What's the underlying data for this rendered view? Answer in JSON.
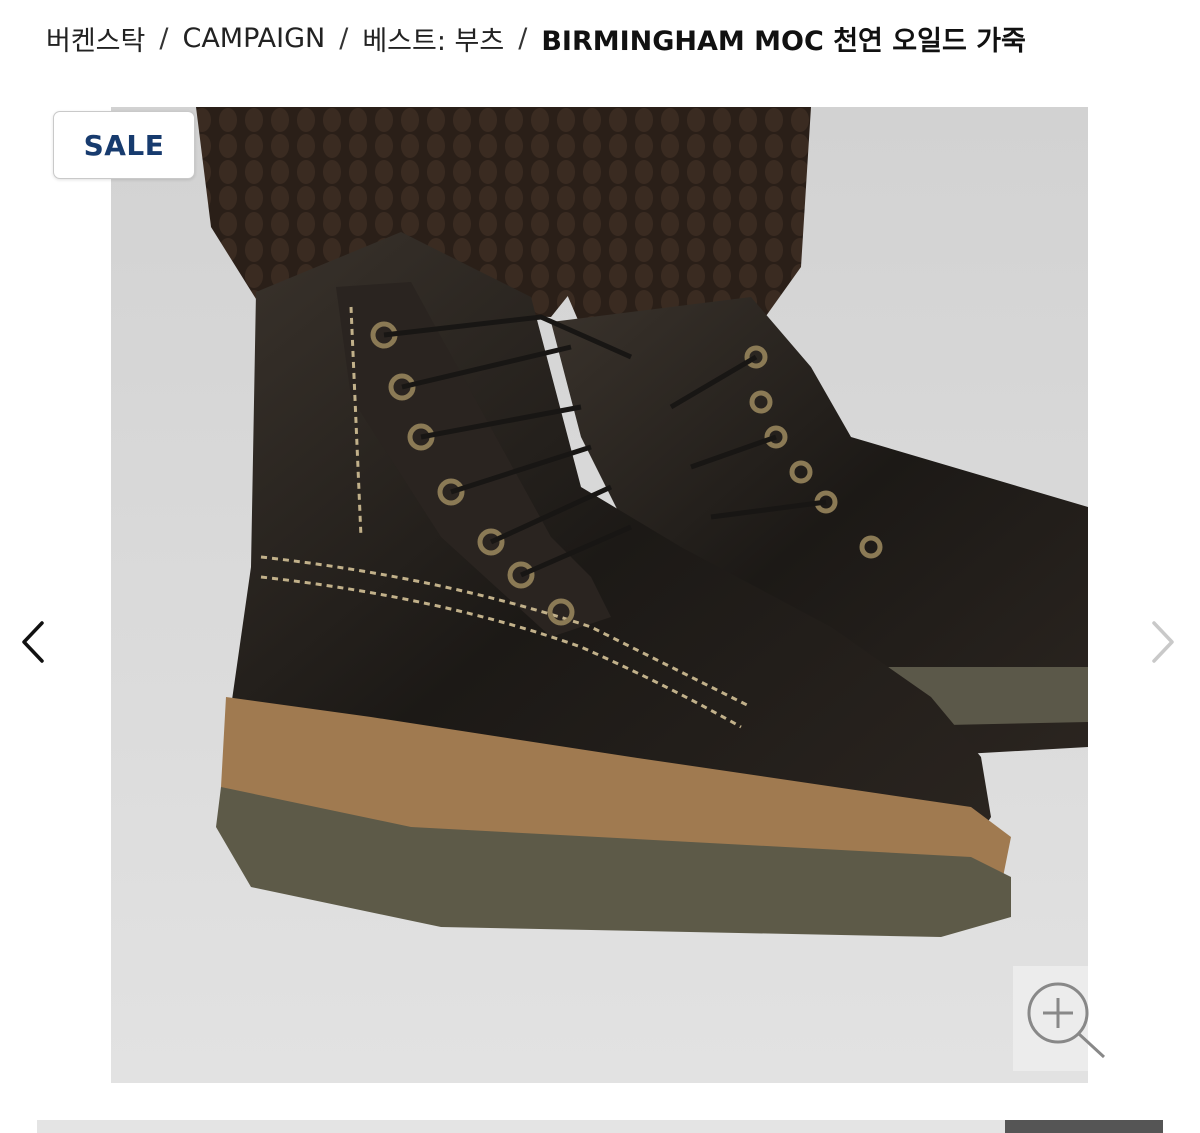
{
  "breadcrumb": {
    "items": [
      "버켄스탁",
      "CAMPAIGN",
      "베스트: 부츠"
    ],
    "current": "BIRMINGHAM MOC 천연 오일드 가죽",
    "separator": "/"
  },
  "product": {
    "badge": "SALE",
    "badge_color": "#173b6e",
    "image_alt": "Birmingham Moc boots"
  },
  "gallery": {
    "prev_icon": "chevron-left-icon",
    "next_icon": "chevron-right-icon",
    "zoom_icon": "magnifier-plus-icon",
    "slide_position_fraction": 0.86,
    "slide_indicator_width_fraction": 0.14
  }
}
